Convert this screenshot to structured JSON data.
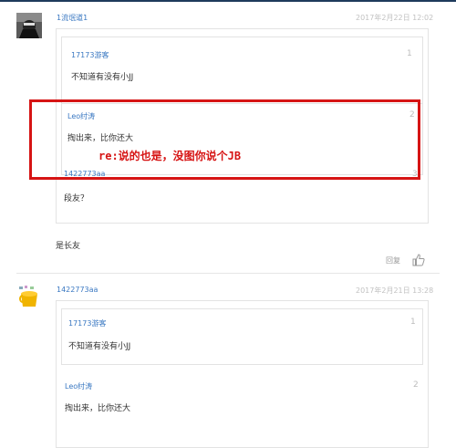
{
  "comment1": {
    "username": "1流氓道1",
    "date": "2017年2月22日 12:02",
    "quotes": [
      {
        "name": "17173游客",
        "num": "1",
        "text": "不知道有没有小JJ"
      },
      {
        "name": "Leo纣涛",
        "num": "2",
        "text": "掏出来，比你还大"
      },
      {
        "name": "1422773aa",
        "num": "3",
        "text": "段友？"
      }
    ],
    "annotation": "re:说的也是，没图你说个JB",
    "body": "是长友",
    "reply_label": "回复"
  },
  "comment2": {
    "username": "1422773aa",
    "date": "2017年2月21日 13:28",
    "quotes": [
      {
        "name": "17173游客",
        "num": "1",
        "text": "不知道有没有小JJ"
      },
      {
        "name": "Leo纣涛",
        "num": "2",
        "text": "掏出来，比你还大"
      }
    ]
  },
  "colors": {
    "link": "#3a78c2",
    "annotation": "#d61414"
  },
  "icons": {
    "like": "thumbs-up-icon"
  }
}
